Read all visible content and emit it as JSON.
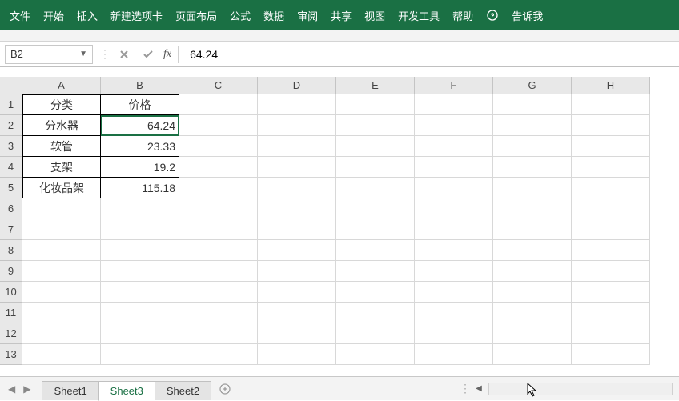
{
  "ribbon": {
    "tabs": [
      "文件",
      "开始",
      "插入",
      "新建选项卡",
      "页面布局",
      "公式",
      "数据",
      "审阅",
      "共享",
      "视图",
      "开发工具",
      "帮助"
    ],
    "tell_me": "告诉我"
  },
  "namebox": {
    "value": "B2"
  },
  "formula": {
    "value": "64.24",
    "fx": "fx"
  },
  "columns": [
    "A",
    "B",
    "C",
    "D",
    "E",
    "F",
    "G",
    "H"
  ],
  "rows": [
    "1",
    "2",
    "3",
    "4",
    "5",
    "6",
    "7",
    "8",
    "9",
    "10",
    "11",
    "12",
    "13"
  ],
  "grid": {
    "r1": {
      "A": "分类",
      "B": "价格"
    },
    "r2": {
      "A": "分水器",
      "B": "64.24"
    },
    "r3": {
      "A": "软管",
      "B": "23.33"
    },
    "r4": {
      "A": "支架",
      "B": "19.2"
    },
    "r5": {
      "A": "化妆品架",
      "B": "115.18"
    }
  },
  "selected_cell": "B2",
  "sheets": {
    "items": [
      "Sheet1",
      "Sheet3",
      "Sheet2"
    ],
    "active": "Sheet3"
  },
  "chart_data": {
    "type": "table",
    "title": "",
    "columns": [
      "分类",
      "价格"
    ],
    "rows": [
      {
        "分类": "分水器",
        "价格": 64.24
      },
      {
        "分类": "软管",
        "价格": 23.33
      },
      {
        "分类": "支架",
        "价格": 19.2
      },
      {
        "分类": "化妆品架",
        "价格": 115.18
      }
    ]
  }
}
